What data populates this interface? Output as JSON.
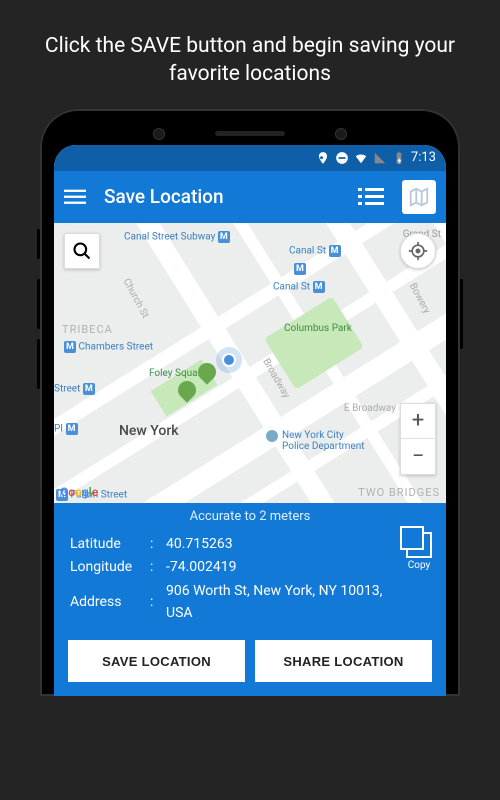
{
  "promo": {
    "text": "Click the SAVE button and begin saving your favorite locations"
  },
  "statusbar": {
    "time": "7:13"
  },
  "appbar": {
    "title": "Save Location"
  },
  "map": {
    "labels": {
      "canal_st_subway": "Canal Street Subway",
      "grand_st": "Grand St",
      "canal_st_1": "Canal St",
      "canal_st_2": "Canal St",
      "church_st": "Church St",
      "bowery": "Bowery",
      "tribeca": "TRIBECA",
      "chambers_street": "Chambers Street",
      "foley_square": "Foley Square",
      "columbus_park": "Columbus Park",
      "new_york": "New York",
      "broadway": "Broadway",
      "e_broadway": "E Broadway",
      "nypd": "New York City Police Department",
      "fulton_street": "Fulton Street",
      "two_bridges": "TWO BRIDGES",
      "street": "Street",
      "pi": "PI"
    },
    "metro_symbol": "M"
  },
  "info": {
    "accuracy": "Accurate to 2 meters",
    "lat_label": "Latitude",
    "lon_label": "Longitude",
    "addr_label": "Address",
    "latitude": "40.715263",
    "longitude": "-74.002419",
    "address": "906 Worth St, New York, NY 10013, USA",
    "copy_label": "Copy"
  },
  "buttons": {
    "save": "SAVE LOCATION",
    "share": "SHARE LOCATION"
  }
}
